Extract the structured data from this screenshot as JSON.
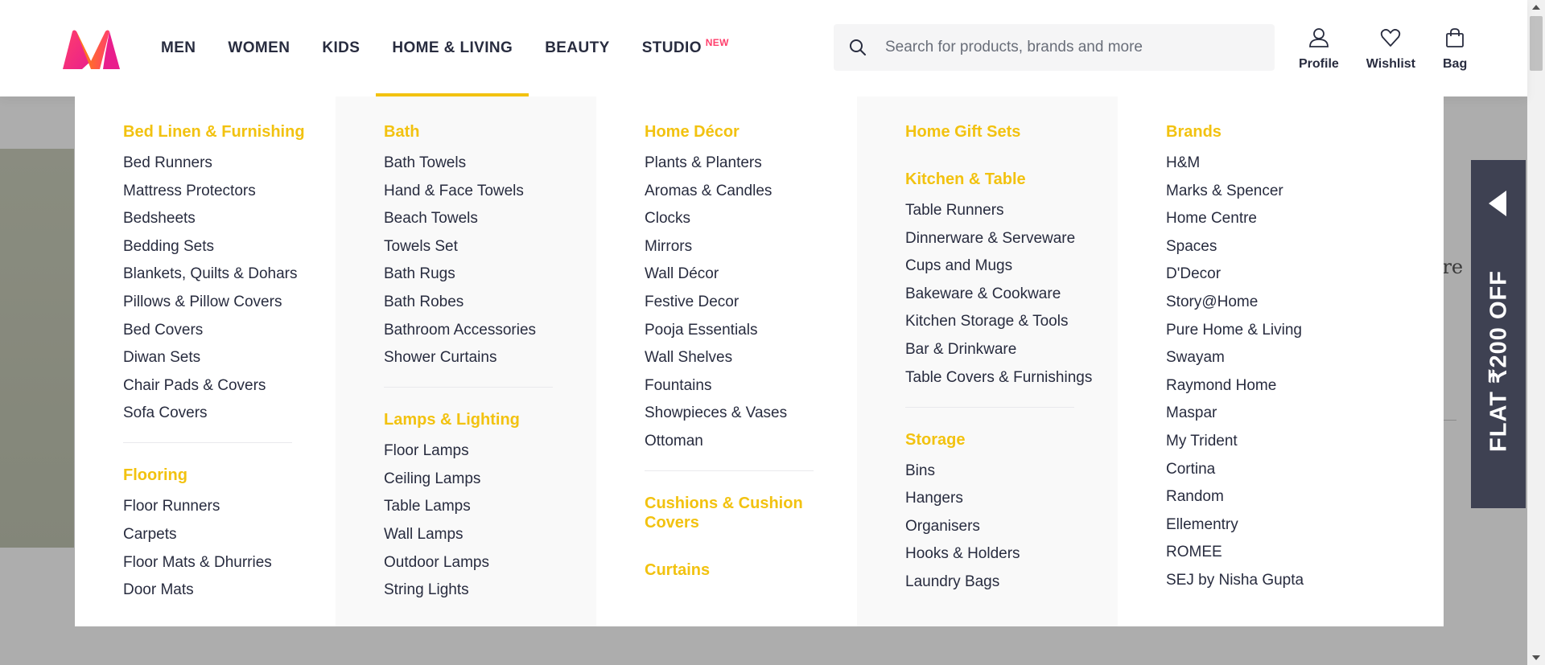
{
  "colors": {
    "accent": "#f2c210",
    "new_badge": "#ff3f6c",
    "text": "#282c3f",
    "offer_tab": "#3e4152"
  },
  "header": {
    "logo": "myntra-logo",
    "nav": [
      {
        "label": "MEN"
      },
      {
        "label": "WOMEN"
      },
      {
        "label": "KIDS"
      },
      {
        "label": "HOME & LIVING",
        "active": true
      },
      {
        "label": "BEAUTY"
      },
      {
        "label": "STUDIO",
        "badge": "NEW"
      }
    ],
    "search": {
      "icon": "search-icon",
      "placeholder": "Search for products, brands and more"
    },
    "actions": [
      {
        "label": "Profile",
        "icon": "profile-icon"
      },
      {
        "label": "Wishlist",
        "icon": "heart-icon"
      },
      {
        "label": "Bag",
        "icon": "bag-icon"
      }
    ]
  },
  "background": {
    "peek_text": "ore"
  },
  "offer_tab": {
    "text": "FLAT ₹200 OFF",
    "icon": "play-left-icon"
  },
  "menu": {
    "col1": {
      "groups": [
        {
          "title": "Bed Linen & Furnishing",
          "items": [
            "Bed Runners",
            "Mattress Protectors",
            "Bedsheets",
            "Bedding Sets",
            "Blankets, Quilts & Dohars",
            "Pillows & Pillow Covers",
            "Bed Covers",
            "Diwan Sets",
            "Chair Pads & Covers",
            "Sofa Covers"
          ]
        },
        {
          "title": "Flooring",
          "items": [
            "Floor Runners",
            "Carpets",
            "Floor Mats & Dhurries",
            "Door Mats"
          ]
        }
      ]
    },
    "col2": {
      "groups": [
        {
          "title": "Bath",
          "items": [
            "Bath Towels",
            "Hand & Face Towels",
            "Beach Towels",
            "Towels Set",
            "Bath Rugs",
            "Bath Robes",
            "Bathroom Accessories",
            "Shower Curtains"
          ]
        },
        {
          "title": "Lamps & Lighting",
          "items": [
            "Floor Lamps",
            "Ceiling Lamps",
            "Table Lamps",
            "Wall Lamps",
            "Outdoor Lamps",
            "String Lights"
          ]
        }
      ]
    },
    "col3": {
      "groups": [
        {
          "title": "Home Décor",
          "items": [
            "Plants & Planters",
            "Aromas & Candles",
            "Clocks",
            "Mirrors",
            "Wall Décor",
            "Festive Decor",
            "Pooja Essentials",
            "Wall Shelves",
            "Fountains",
            "Showpieces & Vases",
            "Ottoman"
          ]
        }
      ],
      "extra": [
        "Cushions & Cushion Covers",
        "Curtains"
      ]
    },
    "col4": {
      "top": "Home Gift Sets",
      "groups": [
        {
          "title": "Kitchen & Table",
          "items": [
            "Table Runners",
            "Dinnerware & Serveware",
            "Cups and Mugs",
            "Bakeware & Cookware",
            "Kitchen Storage & Tools",
            "Bar & Drinkware",
            "Table Covers & Furnishings"
          ]
        },
        {
          "title": "Storage",
          "items": [
            "Bins",
            "Hangers",
            "Organisers",
            "Hooks & Holders",
            "Laundry Bags"
          ]
        }
      ]
    },
    "col5": {
      "groups": [
        {
          "title": "Brands",
          "items": [
            "H&M",
            "Marks & Spencer",
            "Home Centre",
            "Spaces",
            "D'Decor",
            "Story@Home",
            "Pure Home & Living",
            "Swayam",
            "Raymond Home",
            "Maspar",
            "My Trident",
            "Cortina",
            "Random",
            "Ellementry",
            "ROMEE",
            "SEJ by Nisha Gupta"
          ]
        }
      ]
    }
  }
}
